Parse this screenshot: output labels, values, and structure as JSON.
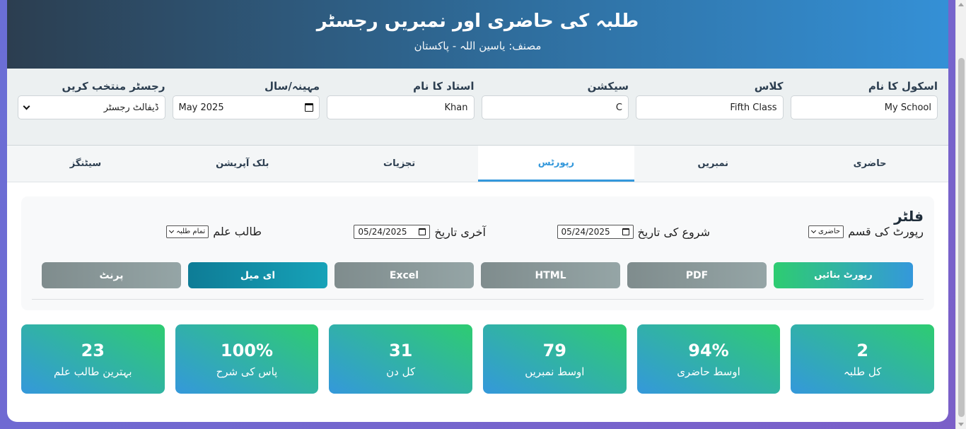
{
  "header": {
    "title": "طلبہ کی حاضری اور نمبریں رجسٹر",
    "author": "مصنف: یاسین اللہ - پاکستان"
  },
  "settings": {
    "school": {
      "label": "اسکول کا نام",
      "value": "My School"
    },
    "class": {
      "label": "کلاس",
      "value": "Fifth Class"
    },
    "section": {
      "label": "سیکشن",
      "value": "C"
    },
    "teacher": {
      "label": "استاد کا نام",
      "value": "Khan"
    },
    "month": {
      "label": "مہینہ/سال",
      "value": "May 2025"
    },
    "register": {
      "label": "رجسٹر منتخب کریں",
      "value": "ڈیفالٹ رجسٹر"
    }
  },
  "tabs": [
    "حاضری",
    "نمبریں",
    "رپورٹس",
    "تجزیات",
    "بلک آپریشن",
    "سیٹنگز"
  ],
  "active_tab": "رپورٹس",
  "reports": {
    "heading": "فلٹر",
    "report_type_label": "رپورٹ کی قسم",
    "report_type_value": "حاضری",
    "start_label": "شروع کی تاریخ",
    "start_value": "05/24/2025",
    "end_label": "آخری تاریخ",
    "end_value": "05/24/2025",
    "student_label": "طالب علم",
    "student_value": "تمام طلبہ",
    "buttons": {
      "generate": "رپورٹ بنائیں",
      "pdf": "PDF",
      "html": "HTML",
      "excel": "Excel",
      "email": "ای میل",
      "print": "پرنٹ"
    }
  },
  "stats": [
    {
      "value": "2",
      "label": "کل طلبہ"
    },
    {
      "value": "94%",
      "label": "اوسط حاضری"
    },
    {
      "value": "79",
      "label": "اوسط نمبریں"
    },
    {
      "value": "31",
      "label": "کل دن"
    },
    {
      "value": "100%",
      "label": "پاس کی شرح"
    },
    {
      "value": "23",
      "label": "بہترین طالب علم"
    }
  ],
  "colors": {
    "accent": "#3498db",
    "success": "#2ecc71",
    "dark": "#2c3e50",
    "email": "#17a2b8",
    "export": "#95a5a6"
  },
  "icons": [
    "calendar-icon",
    "chevron-down-icon"
  ]
}
